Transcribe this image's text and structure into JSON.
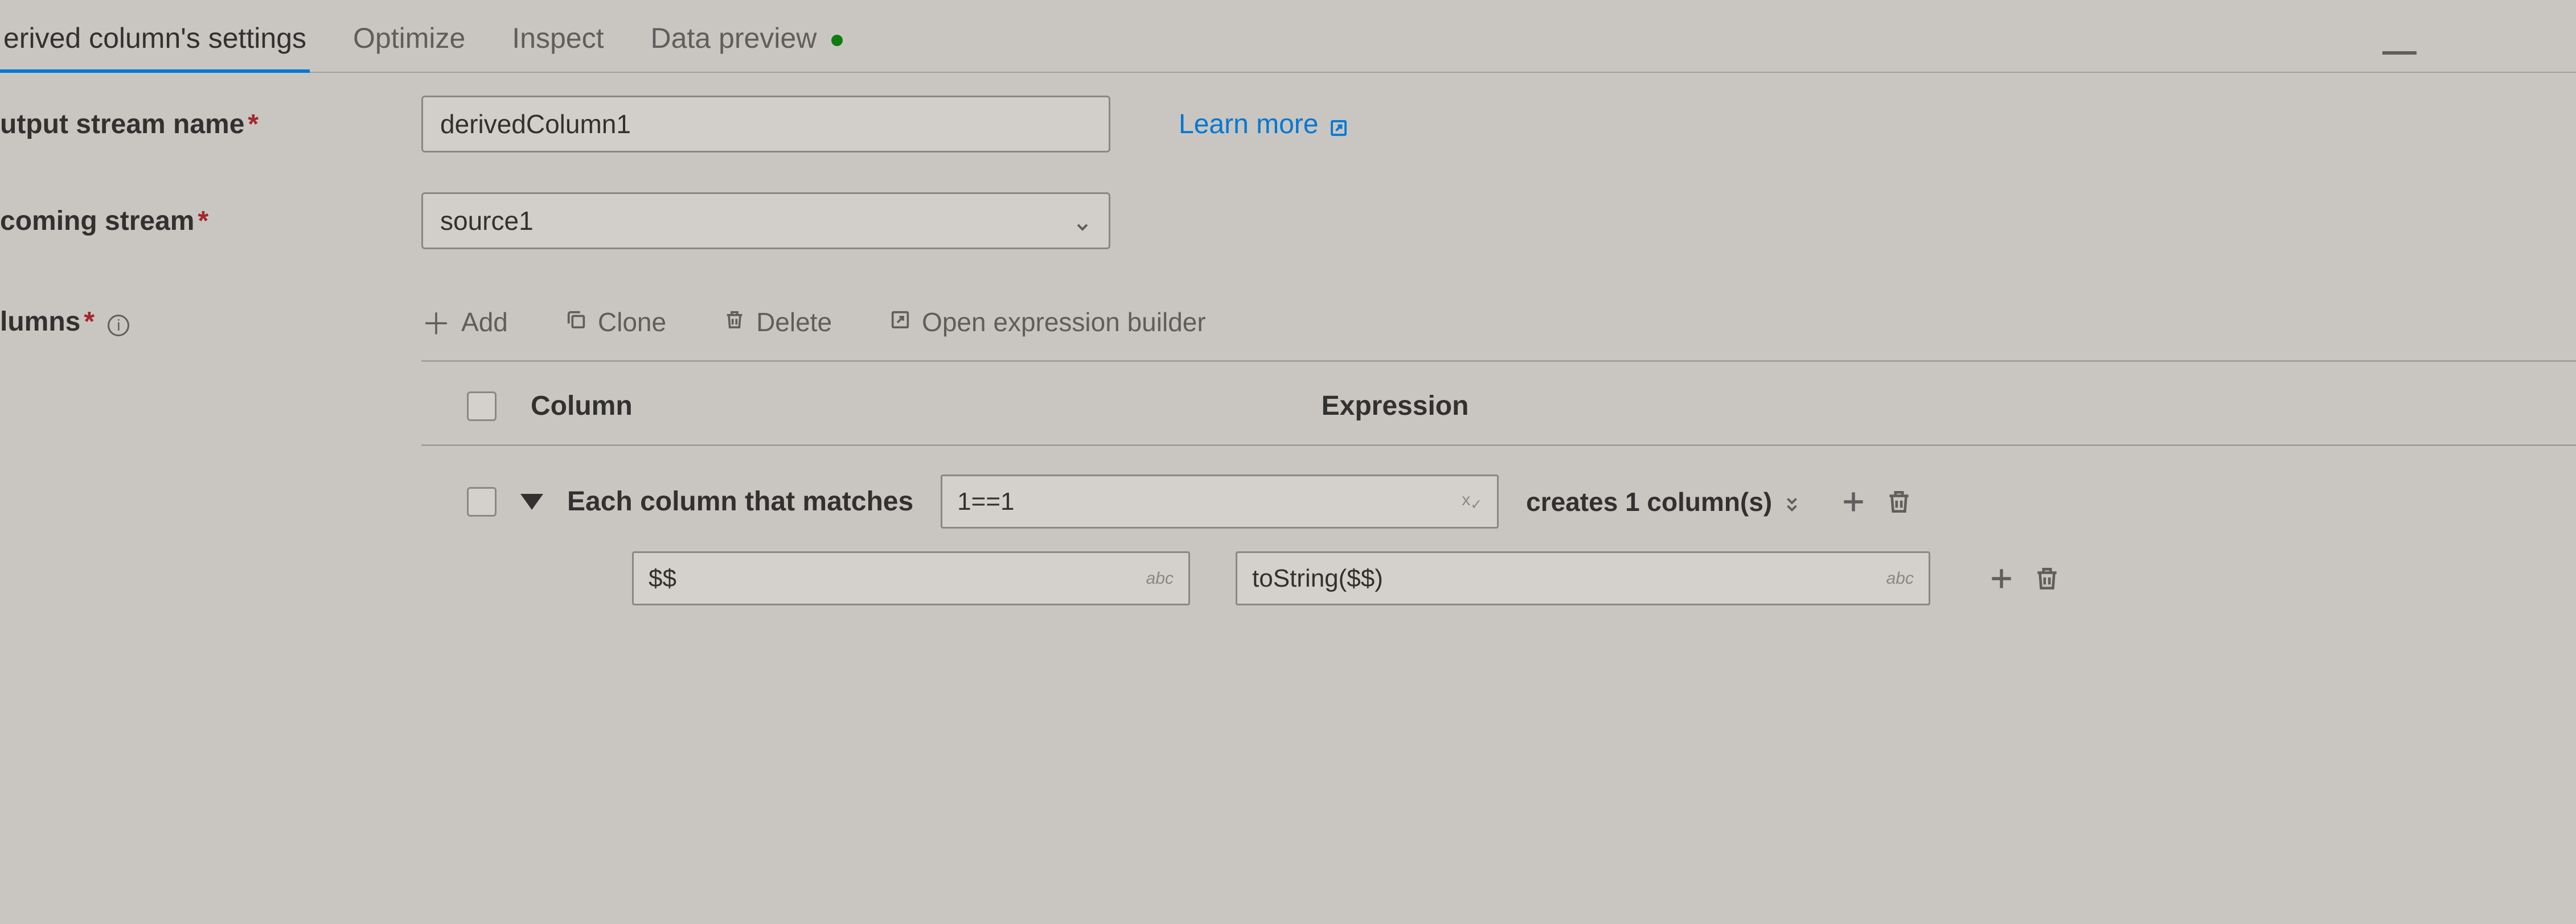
{
  "tabs": {
    "settings": "erived column's settings",
    "optimize": "Optimize",
    "inspect": "Inspect",
    "preview": "Data preview"
  },
  "form": {
    "outputStreamLabel": "utput stream name",
    "outputStreamValue": "derivedColumn1",
    "learnMore": "Learn more",
    "incomingStreamLabel": "coming stream",
    "incomingStreamValue": "source1",
    "columnsLabel": "lumns"
  },
  "toolbar": {
    "add": "Add",
    "clone": "Clone",
    "delete": "Delete",
    "openExpr": "Open expression builder"
  },
  "headers": {
    "column": "Column",
    "expression": "Expression"
  },
  "pattern": {
    "matchLabel": "Each column that matches",
    "condition": "1==1",
    "createsText": "creates 1 column(s)",
    "nameExpr": "$$",
    "valueExpr": "toString($$)",
    "typeAbc": "abc"
  }
}
